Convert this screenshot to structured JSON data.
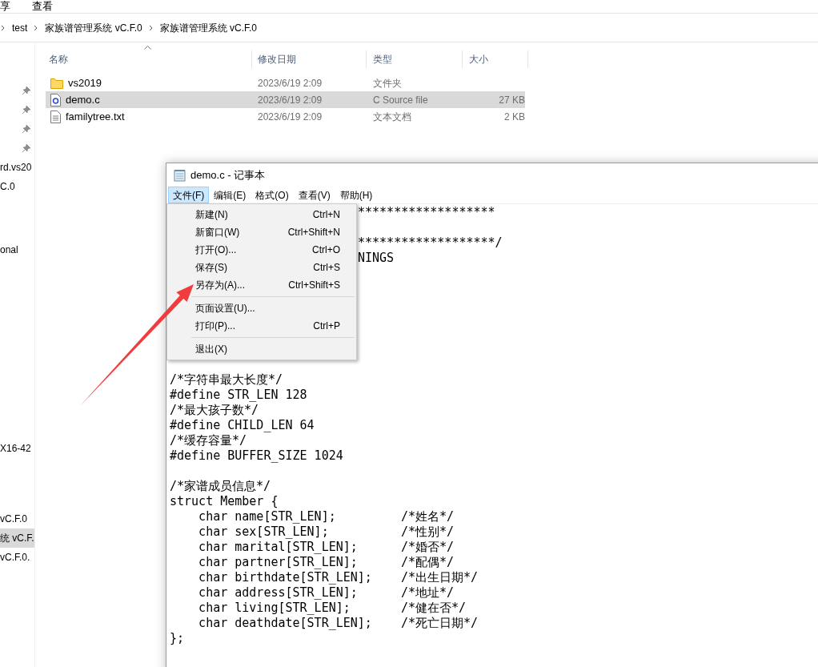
{
  "explorer": {
    "ribbon_tabs": [
      "享",
      "查看"
    ],
    "breadcrumb": [
      "test",
      "家族谱管理系统 vC.F.0",
      "家族谱管理系统 vC.F.0"
    ],
    "nav_items": [
      {
        "label": "rd.vs20",
        "selected": false
      },
      {
        "label": "C.0",
        "selected": false
      },
      {
        "label": "onal",
        "selected": false
      },
      {
        "label": "X16-42",
        "selected": false
      },
      {
        "label": "vC.F.0",
        "selected": false
      },
      {
        "label": "统 vC.F.",
        "selected": true
      },
      {
        "label": "vC.F.0.",
        "selected": false
      }
    ],
    "columns": [
      "名称",
      "修改日期",
      "类型",
      "大小"
    ],
    "files": [
      {
        "kind": "folder",
        "name": "vs2019",
        "date": "2023/6/19 2:09",
        "type": "文件夹",
        "selected": false
      },
      {
        "kind": "c",
        "name": "demo.c",
        "date": "2023/6/19 2:09",
        "type": "C Source file",
        "size": "27 KB",
        "selected": true
      },
      {
        "kind": "text",
        "name": "familytree.txt",
        "date": "2023/6/19 2:09",
        "type": "文本文档",
        "size": "2 KB",
        "selected": false
      }
    ]
  },
  "notepad": {
    "title": "demo.c - 记事本",
    "menu_bar": [
      {
        "label": "文件(F)",
        "selected": true
      },
      {
        "label": "编辑(E)",
        "selected": false
      },
      {
        "label": "格式(O)",
        "selected": false
      },
      {
        "label": "查看(V)",
        "selected": false
      },
      {
        "label": "帮助(H)",
        "selected": false
      }
    ],
    "file_menu": [
      {
        "kind": "item",
        "label": "新建(N)",
        "shortcut": "Ctrl+N"
      },
      {
        "kind": "item",
        "label": "新窗口(W)",
        "shortcut": "Ctrl+Shift+N"
      },
      {
        "kind": "item",
        "label": "打开(O)...",
        "shortcut": "Ctrl+O"
      },
      {
        "kind": "item",
        "label": "保存(S)",
        "shortcut": "Ctrl+S"
      },
      {
        "kind": "item",
        "label": "另存为(A)...",
        "shortcut": "Ctrl+Shift+S"
      },
      {
        "kind": "separator"
      },
      {
        "kind": "item",
        "label": "页面设置(U)..."
      },
      {
        "kind": "item",
        "label": "打印(P)...",
        "shortcut": "Ctrl+P"
      },
      {
        "kind": "separator"
      },
      {
        "kind": "item",
        "label": "退出(X)"
      }
    ],
    "code_lines": [
      {
        "kind": "text",
        "text": "*******************",
        "covered": true
      },
      {
        "kind": "blank"
      },
      {
        "kind": "text",
        "text": "*******************/",
        "covered": true
      },
      {
        "kind": "text",
        "text": "NINGS",
        "covered": true
      },
      {
        "kind": "blank"
      },
      {
        "kind": "blank"
      },
      {
        "kind": "blank"
      },
      {
        "kind": "blank"
      },
      {
        "kind": "blank"
      },
      {
        "kind": "blank"
      },
      {
        "kind": "blank"
      },
      {
        "kind": "text",
        "text": "/*字符串最大长度*/",
        "covered": false
      },
      {
        "text": "#define STR_LEN 128",
        "covered": false
      },
      {
        "text": "/*最大孩子数*/",
        "covered": false
      },
      {
        "text": "#define CHILD_LEN 64",
        "covered": false
      },
      {
        "text": "/*缓存容量*/",
        "covered": false
      },
      {
        "text": "#define BUFFER_SIZE 1024",
        "covered": false
      },
      {
        "kind": "blank"
      },
      {
        "text": "/*家谱成员信息*/",
        "covered": false
      },
      {
        "text": "struct Member {",
        "covered": false
      },
      {
        "text": "    char name[STR_LEN];         /*姓名*/",
        "covered": false
      },
      {
        "text": "    char sex[STR_LEN];          /*性别*/",
        "covered": false
      },
      {
        "text": "    char marital[STR_LEN];      /*婚否*/",
        "covered": false
      },
      {
        "text": "    char partner[STR_LEN];      /*配偶*/",
        "covered": false
      },
      {
        "text": "    char birthdate[STR_LEN];    /*出生日期*/",
        "covered": false
      },
      {
        "text": "    char address[STR_LEN];      /*地址*/",
        "covered": false
      },
      {
        "text": "    char living[STR_LEN];       /*健在否*/",
        "covered": false
      },
      {
        "text": "    char deathdate[STR_LEN];    /*死亡日期*/",
        "covered": false
      },
      {
        "text": "};",
        "covered": false
      }
    ]
  }
}
